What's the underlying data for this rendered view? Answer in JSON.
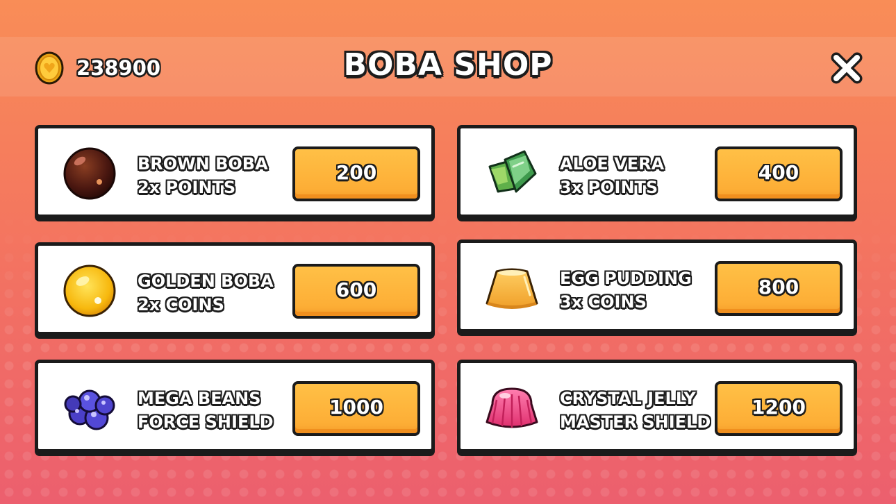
{
  "header": {
    "coins": "238900",
    "title": "BOBA SHOP"
  },
  "icons": {
    "coin": "coin-icon",
    "close": "close-icon"
  },
  "items": [
    {
      "name": "BROWN BOBA",
      "effect": "2x POINTS",
      "price": "200",
      "icon": "brown-boba-icon"
    },
    {
      "name": "ALOE VERA",
      "effect": "3x POINTS",
      "price": "400",
      "icon": "aloe-vera-icon"
    },
    {
      "name": "GOLDEN BOBA",
      "effect": "2x COINS",
      "price": "600",
      "icon": "golden-boba-icon"
    },
    {
      "name": "EGG PUDDING",
      "effect": "3x COINS",
      "price": "800",
      "icon": "egg-pudding-icon"
    },
    {
      "name": "MEGA BEANS",
      "effect": "FORCE SHIELD",
      "price": "1000",
      "icon": "mega-beans-icon"
    },
    {
      "name": "CRYSTAL JELLY",
      "effect": "MASTER SHIELD",
      "price": "1200",
      "icon": "crystal-jelly-icon"
    }
  ],
  "colors": {
    "background_top": "#f98d57",
    "background_bottom": "#ec5f6e",
    "button": "#fdae36",
    "outline": "#1b1b1b"
  }
}
